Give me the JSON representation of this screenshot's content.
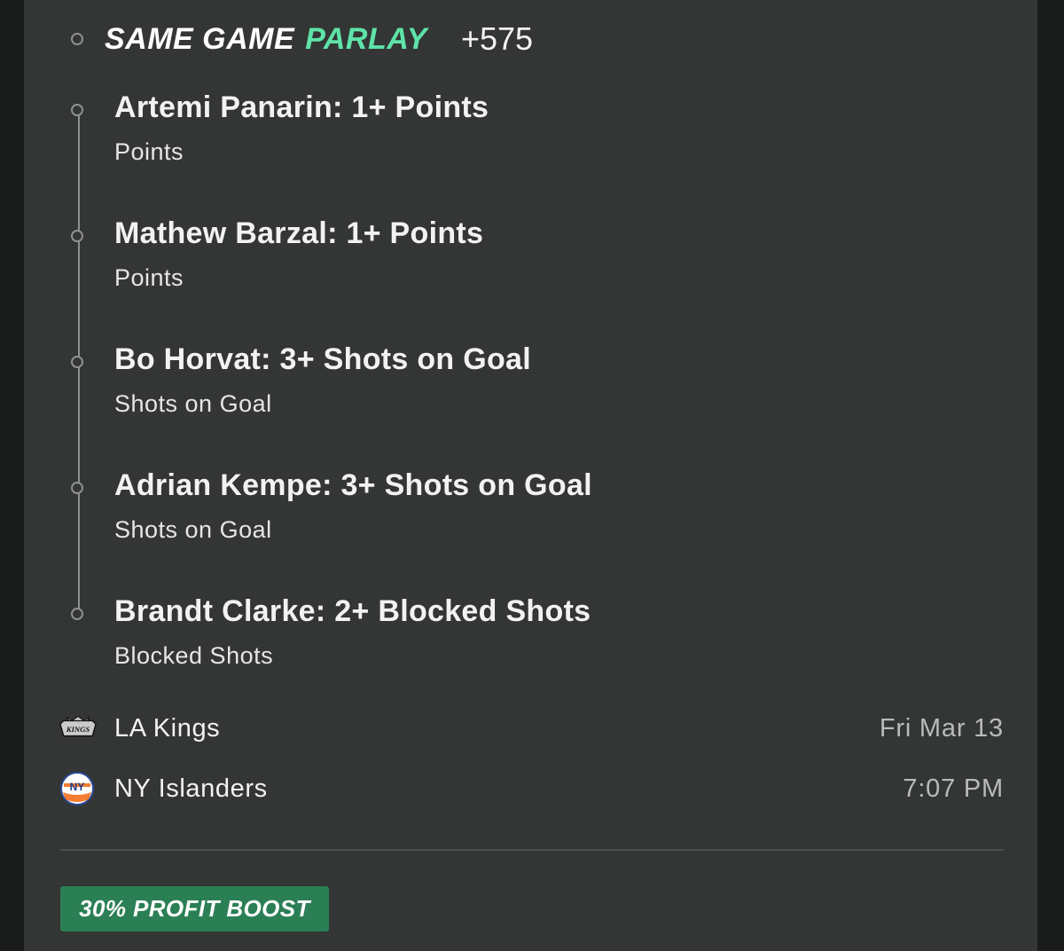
{
  "parlay": {
    "title_part1": "SAME GAME",
    "title_part2": "PARLAY",
    "odds": "+575"
  },
  "legs": [
    {
      "title": "Artemi Panarin: 1+ Points",
      "market": "Points"
    },
    {
      "title": "Mathew Barzal: 1+ Points",
      "market": "Points"
    },
    {
      "title": "Bo Horvat: 3+ Shots on Goal",
      "market": "Shots on Goal"
    },
    {
      "title": "Adrian Kempe: 3+ Shots on Goal",
      "market": "Shots on Goal"
    },
    {
      "title": "Brandt Clarke: 2+ Blocked Shots",
      "market": "Blocked Shots"
    }
  ],
  "game": {
    "away_team": {
      "name": "LA Kings",
      "logo_text": "KINGS",
      "logo_icon": "la-kings-logo-icon"
    },
    "home_team": {
      "name": "NY Islanders",
      "logo_text": "NY",
      "logo_icon": "ny-islanders-logo-icon"
    },
    "date": "Fri Mar 13",
    "time": "7:07 PM"
  },
  "promo": {
    "label": "30% PROFIT BOOST"
  },
  "colors": {
    "accent_green": "#5ee3a8",
    "boost_green": "#2b7f55",
    "card_bg": "#333634",
    "timeline_gray": "#8f918f",
    "muted_text": "#b9bbb9"
  }
}
